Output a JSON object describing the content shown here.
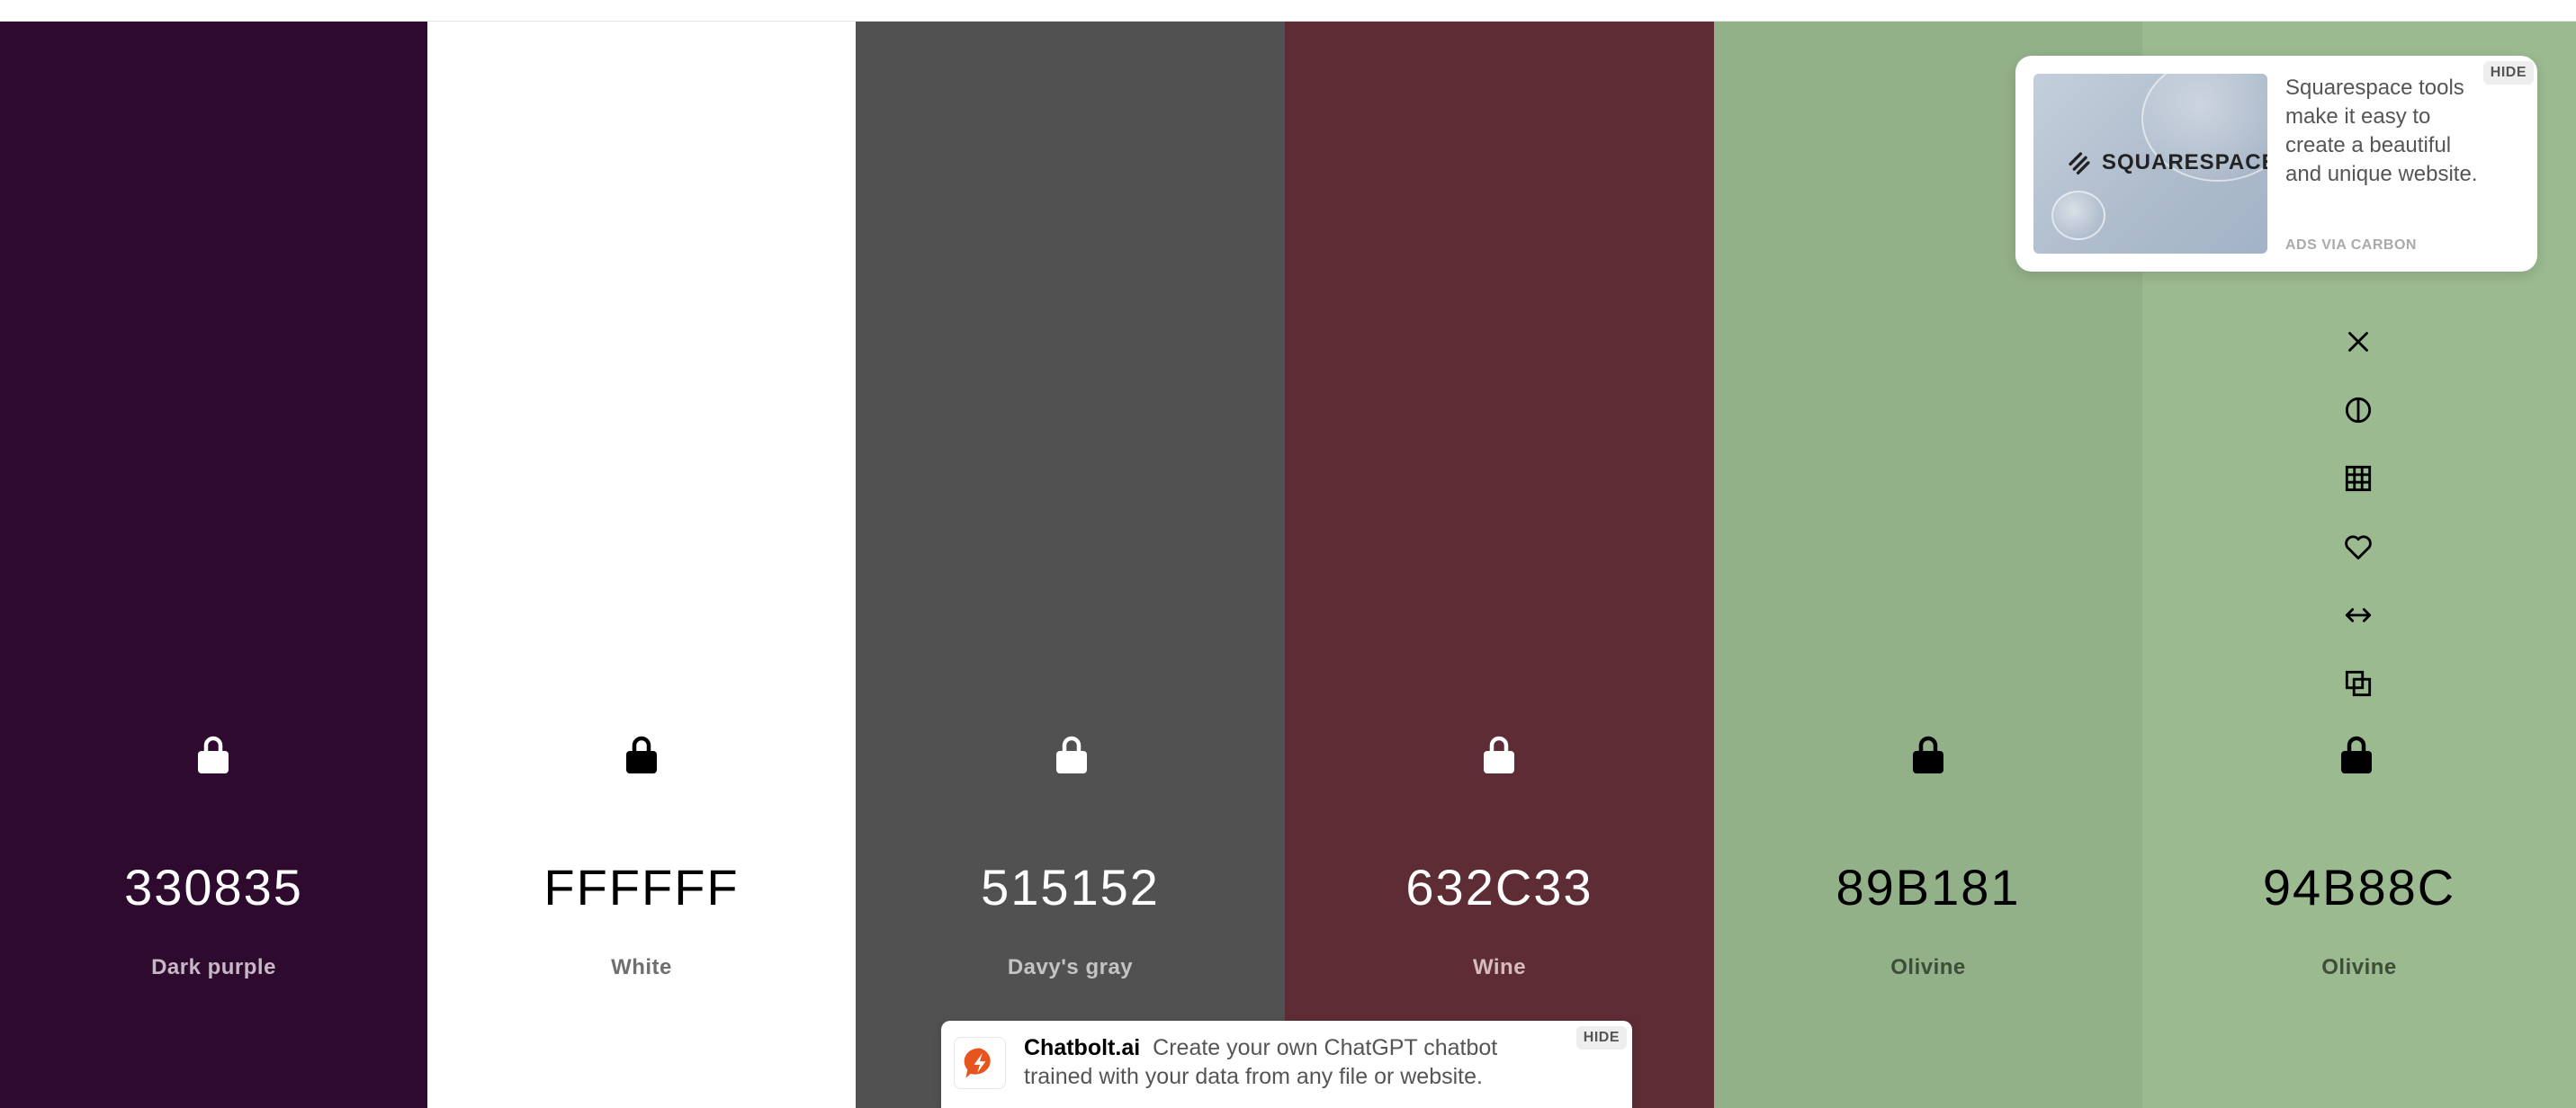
{
  "palette": [
    {
      "hex": "330835",
      "name": "Dark purple",
      "bg": "#2d0a2e",
      "text_color": "#ffffff",
      "name_color": "#c6b8c6",
      "lock_color": "#ffffff"
    },
    {
      "hex": "FFFFFF",
      "name": "White",
      "bg": "#ffffff",
      "text_color": "#000000",
      "name_color": "#6f6f6f",
      "lock_color": "#000000"
    },
    {
      "hex": "515152",
      "name": "Davy's gray",
      "bg": "#515151",
      "text_color": "#ffffff",
      "name_color": "#c4c4c4",
      "lock_color": "#ffffff"
    },
    {
      "hex": "632C33",
      "name": "Wine",
      "bg": "#5e2c34",
      "text_color": "#ffffff",
      "name_color": "#d5bcbf",
      "lock_color": "#ffffff"
    },
    {
      "hex": "89B181",
      "name": "Olivine",
      "bg": "#93b188",
      "text_color": "#000000",
      "name_color": "#3d4d38",
      "lock_color": "#000000"
    },
    {
      "hex": "94B88C",
      "name": "Olivine",
      "bg": "#9bba90",
      "text_color": "#000000",
      "name_color": "#3d4d38",
      "lock_color": "#000000"
    }
  ],
  "tools": [
    {
      "name": "remove-color-icon",
      "icon": "close"
    },
    {
      "name": "shades-icon",
      "icon": "contrast-circle"
    },
    {
      "name": "grid-view-icon",
      "icon": "grid"
    },
    {
      "name": "favorite-icon",
      "icon": "heart"
    },
    {
      "name": "drag-icon",
      "icon": "arrows-horizontal"
    },
    {
      "name": "copy-icon",
      "icon": "copy"
    }
  ],
  "carbon_ad": {
    "brand": "SQUARESPACE",
    "text": "Squarespace tools make it easy to create a beautiful and unique website.",
    "via": "ADS VIA CARBON",
    "hide_label": "HIDE"
  },
  "chatbolt_ad": {
    "title": "Chatbolt.ai",
    "text": "Create your own ChatGPT chatbot trained with your data from any file or website.",
    "hide_label": "HIDE",
    "accent": "#e8541e"
  }
}
